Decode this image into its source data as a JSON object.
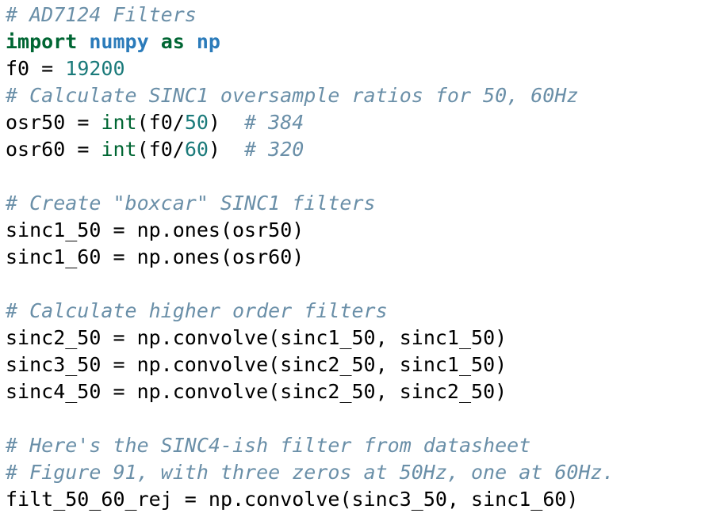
{
  "editor": {
    "language": "python",
    "background_color": "#ffffff",
    "default_text_color": "#000000",
    "theme_colors": {
      "comment": "#6a8fa8",
      "keyword": "#006633",
      "module": "#2b7bba",
      "number": "#1a7a7a",
      "builtin": "#006633",
      "plain": "#000000"
    }
  },
  "code": {
    "lines": [
      {
        "index": 0,
        "text": "# AD7124 Filters",
        "tokens": [
          {
            "t": "# AD7124 Filters",
            "c": "comment"
          }
        ]
      },
      {
        "index": 1,
        "text": "import numpy as np",
        "tokens": [
          {
            "t": "import",
            "c": "keyword"
          },
          {
            "t": " ",
            "c": "plain"
          },
          {
            "t": "numpy",
            "c": "module"
          },
          {
            "t": " ",
            "c": "plain"
          },
          {
            "t": "as",
            "c": "keyword"
          },
          {
            "t": " ",
            "c": "plain"
          },
          {
            "t": "np",
            "c": "module"
          }
        ]
      },
      {
        "index": 2,
        "text": "f0 = 19200",
        "tokens": [
          {
            "t": "f0 ",
            "c": "plain"
          },
          {
            "t": "=",
            "c": "op"
          },
          {
            "t": " ",
            "c": "plain"
          },
          {
            "t": "19200",
            "c": "number"
          }
        ]
      },
      {
        "index": 3,
        "text": "# Calculate SINC1 oversample ratios for 50, 60Hz",
        "tokens": [
          {
            "t": "# Calculate SINC1 oversample ratios for 50, 60Hz",
            "c": "comment"
          }
        ]
      },
      {
        "index": 4,
        "text": "osr50 = int(f0/50)  # 384",
        "tokens": [
          {
            "t": "osr50 ",
            "c": "plain"
          },
          {
            "t": "=",
            "c": "op"
          },
          {
            "t": " ",
            "c": "plain"
          },
          {
            "t": "int",
            "c": "builtin"
          },
          {
            "t": "(f0/",
            "c": "plain"
          },
          {
            "t": "50",
            "c": "number"
          },
          {
            "t": ")  ",
            "c": "plain"
          },
          {
            "t": "# 384",
            "c": "comment"
          }
        ]
      },
      {
        "index": 5,
        "text": "osr60 = int(f0/60)  # 320",
        "tokens": [
          {
            "t": "osr60 ",
            "c": "plain"
          },
          {
            "t": "=",
            "c": "op"
          },
          {
            "t": " ",
            "c": "plain"
          },
          {
            "t": "int",
            "c": "builtin"
          },
          {
            "t": "(f0/",
            "c": "plain"
          },
          {
            "t": "60",
            "c": "number"
          },
          {
            "t": ")  ",
            "c": "plain"
          },
          {
            "t": "# 320",
            "c": "comment"
          }
        ]
      },
      {
        "index": 6,
        "text": "",
        "tokens": []
      },
      {
        "index": 7,
        "text": "# Create \"boxcar\" SINC1 filters",
        "tokens": [
          {
            "t": "# Create \"boxcar\" SINC1 filters",
            "c": "comment"
          }
        ]
      },
      {
        "index": 8,
        "text": "sinc1_50 = np.ones(osr50)",
        "tokens": [
          {
            "t": "sinc1_50 ",
            "c": "plain"
          },
          {
            "t": "=",
            "c": "op"
          },
          {
            "t": " np.ones(osr50)",
            "c": "plain"
          }
        ]
      },
      {
        "index": 9,
        "text": "sinc1_60 = np.ones(osr60)",
        "tokens": [
          {
            "t": "sinc1_60 ",
            "c": "plain"
          },
          {
            "t": "=",
            "c": "op"
          },
          {
            "t": " np.ones(osr60)",
            "c": "plain"
          }
        ]
      },
      {
        "index": 10,
        "text": "",
        "tokens": []
      },
      {
        "index": 11,
        "text": "# Calculate higher order filters",
        "tokens": [
          {
            "t": "# Calculate higher order filters",
            "c": "comment"
          }
        ]
      },
      {
        "index": 12,
        "text": "sinc2_50 = np.convolve(sinc1_50, sinc1_50)",
        "tokens": [
          {
            "t": "sinc2_50 ",
            "c": "plain"
          },
          {
            "t": "=",
            "c": "op"
          },
          {
            "t": " np.convolve(sinc1_50, sinc1_50)",
            "c": "plain"
          }
        ]
      },
      {
        "index": 13,
        "text": "sinc3_50 = np.convolve(sinc2_50, sinc1_50)",
        "tokens": [
          {
            "t": "sinc3_50 ",
            "c": "plain"
          },
          {
            "t": "=",
            "c": "op"
          },
          {
            "t": " np.convolve(sinc2_50, sinc1_50)",
            "c": "plain"
          }
        ]
      },
      {
        "index": 14,
        "text": "sinc4_50 = np.convolve(sinc2_50, sinc2_50)",
        "tokens": [
          {
            "t": "sinc4_50 ",
            "c": "plain"
          },
          {
            "t": "=",
            "c": "op"
          },
          {
            "t": " np.convolve(sinc2_50, sinc2_50)",
            "c": "plain"
          }
        ]
      },
      {
        "index": 15,
        "text": "",
        "tokens": []
      },
      {
        "index": 16,
        "text": "# Here's the SINC4-ish filter from datasheet",
        "tokens": [
          {
            "t": "# Here's the SINC4-ish filter from datasheet",
            "c": "comment"
          }
        ]
      },
      {
        "index": 17,
        "text": "# Figure 91, with three zeros at 50Hz, one at 60Hz.",
        "tokens": [
          {
            "t": "# Figure 91, with three zeros at 50Hz, one at 60Hz.",
            "c": "comment"
          }
        ]
      },
      {
        "index": 18,
        "text": "filt_50_60_rej = np.convolve(sinc3_50, sinc1_60)",
        "tokens": [
          {
            "t": "filt_50_60_rej ",
            "c": "plain"
          },
          {
            "t": "=",
            "c": "op"
          },
          {
            "t": " np.convolve(sinc3_50, sinc1_60)",
            "c": "plain"
          }
        ]
      }
    ]
  }
}
